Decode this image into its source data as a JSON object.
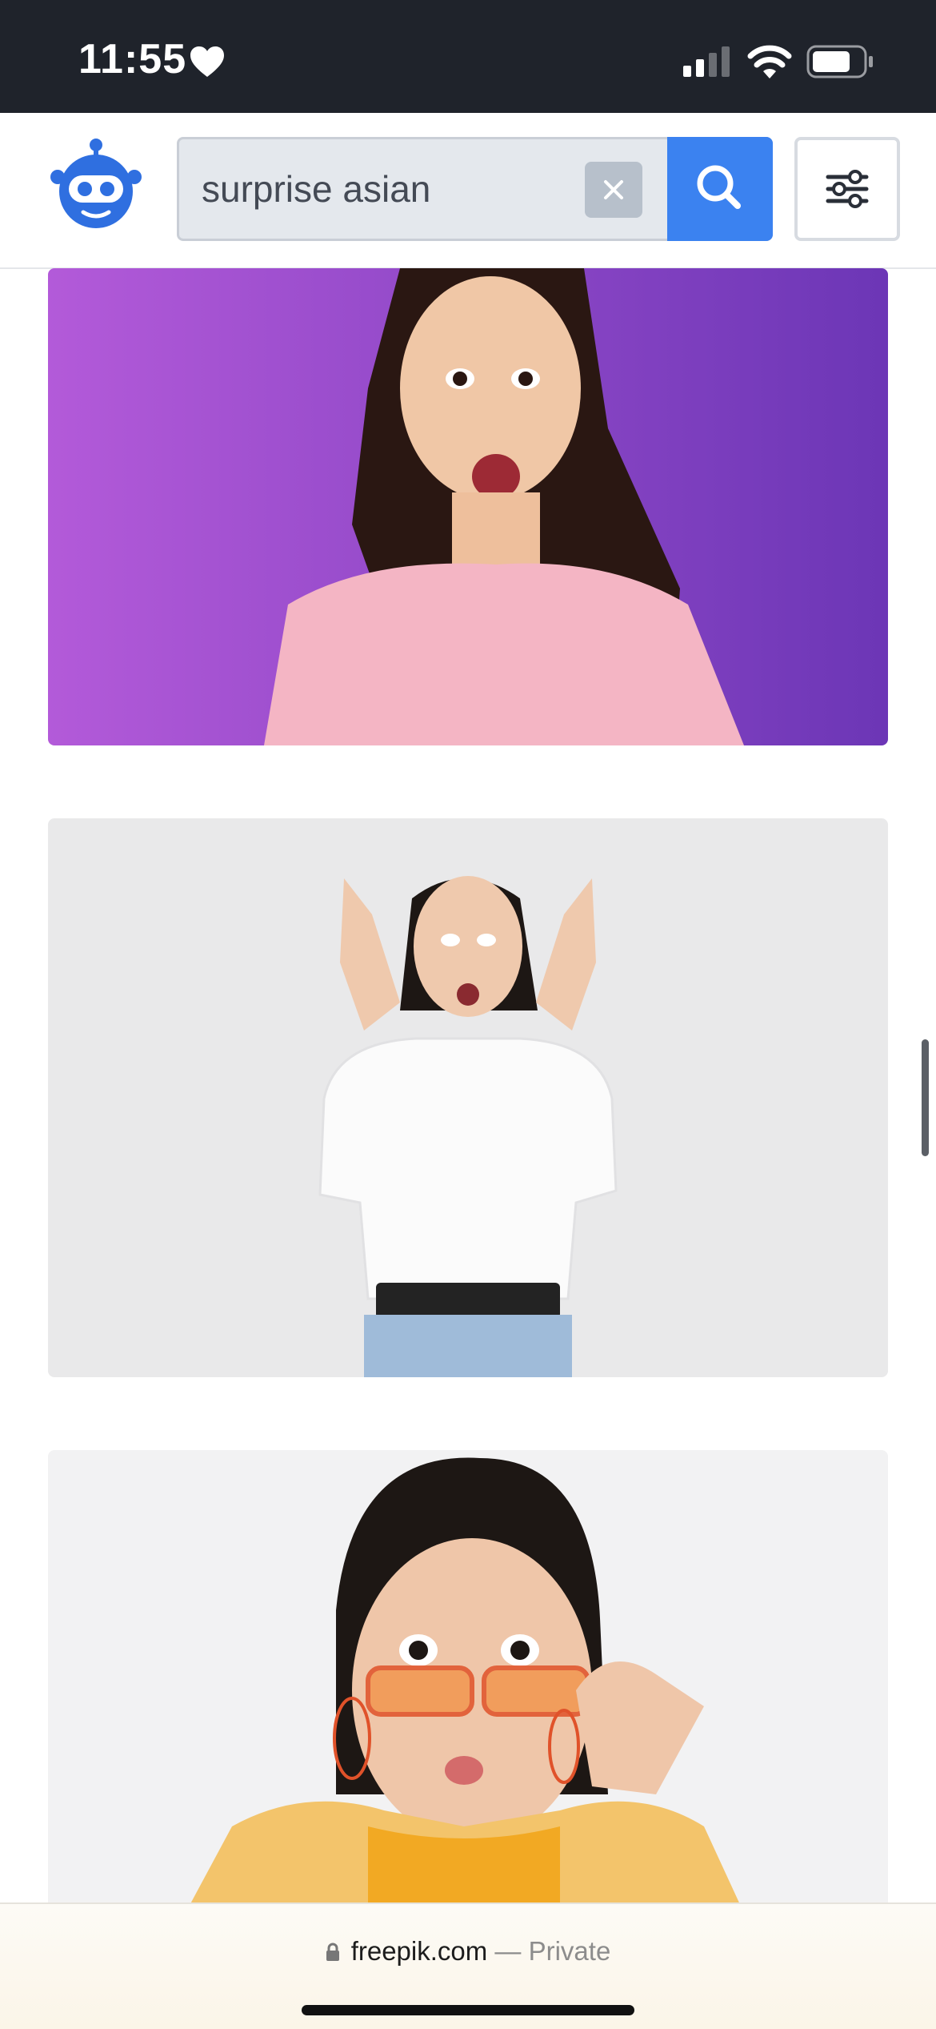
{
  "status_bar": {
    "time": "11:55",
    "icons": [
      "heart-icon",
      "cellular-signal-icon",
      "wifi-icon",
      "battery-icon"
    ]
  },
  "header": {
    "logo": "freepik-robot-logo",
    "search": {
      "value": "surprise asian",
      "placeholder": ""
    },
    "clear_icon": "close-icon",
    "search_icon": "search-icon",
    "filter_icon": "sliders-icon",
    "accent_color": "#3b82f0"
  },
  "results": [
    {
      "subject": "woman in pink t-shirt, surprised face",
      "background": "#8a4fcf"
    },
    {
      "subject": "woman in white shirt with hands near face, shocked",
      "background": "#e9e9ea"
    },
    {
      "subject": "woman in yellow jacket lowering orange sunglasses",
      "background": "#f2f2f3"
    }
  ],
  "browser_bar": {
    "domain": "freepik.com",
    "separator": "—",
    "mode": "Private",
    "lock_icon": "lock-icon"
  }
}
